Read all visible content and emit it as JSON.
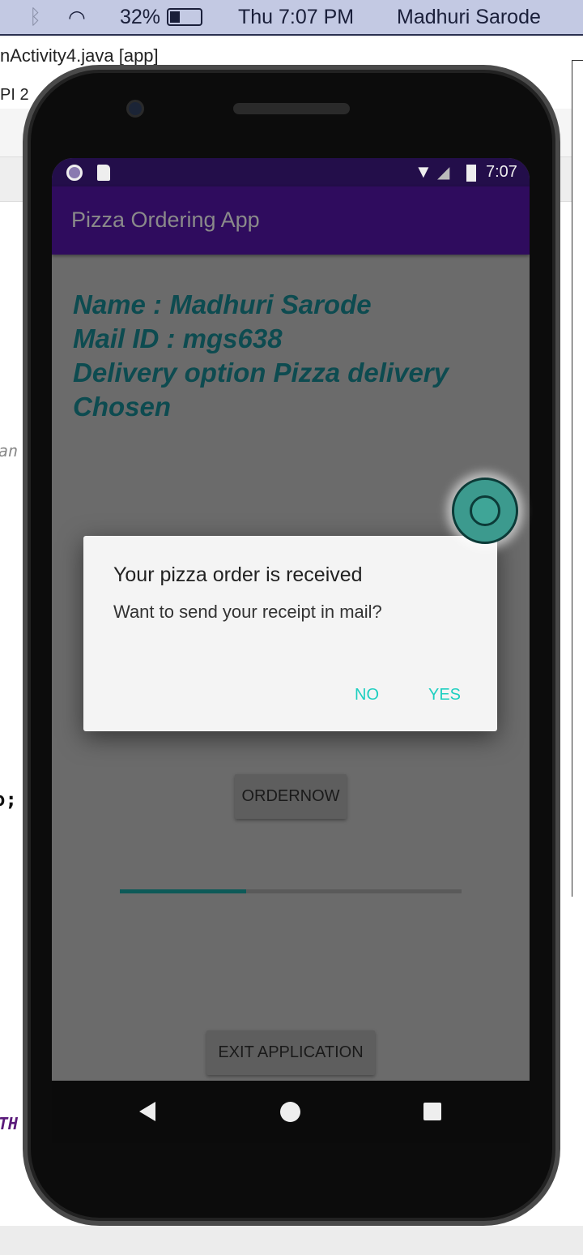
{
  "mac_menubar": {
    "battery": "32%",
    "clock": "Thu 7:07 PM",
    "user": "Madhuri Sarode"
  },
  "ide": {
    "tab_title": "nActivity4.java [app]",
    "api_label": "PI 2",
    "code_fragments": [
      "an",
      "o;",
      "TH"
    ]
  },
  "device": {
    "status_bar": {
      "time": "7:07"
    },
    "app_title": "Pizza Ordering App",
    "info_lines": [
      "Name : Madhuri Sarode",
      "Mail ID : mgs638",
      "Delivery option Pizza delivery",
      "Chosen"
    ],
    "order_button": "ORDERNOW",
    "progress_percent": 37,
    "exit_button": "EXIT APPLICATION",
    "dialog": {
      "title": "Your pizza order is received",
      "message": "Want to send your receipt in mail?",
      "no": "NO",
      "yes": "YES"
    },
    "colors": {
      "accent": "#1ecfc0",
      "app_bar": "#2f0c5e",
      "info_text": "#0d4b50"
    }
  }
}
